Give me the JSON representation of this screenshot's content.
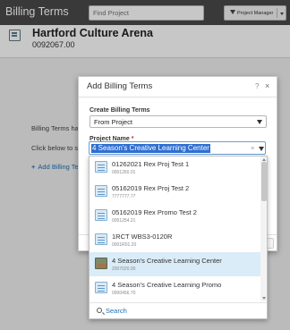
{
  "topbar": {
    "title": "Billing Terms",
    "search_placeholder": "Find Project",
    "filter_label": "Project Manager"
  },
  "record": {
    "title": "Hartford Culture Arena",
    "number": "0092067.00"
  },
  "page": {
    "note": "Billing Terms have not been set up for this record.",
    "click_below": "Click below to sta",
    "add_link": "Add Billing Te"
  },
  "modal": {
    "title": "Add Billing Terms",
    "help": "?",
    "close": "×",
    "create_label": "Create Billing Terms",
    "create_value": "From Project",
    "project_label": "Project Name",
    "required_mark": "*",
    "project_value": "4 Season's Creative Learning Center"
  },
  "dropdown": {
    "items": [
      {
        "name": "01262021 Rex Proj Test 1",
        "number": "0001260.01",
        "icon": "project-icon",
        "highlight": false
      },
      {
        "name": "05162019 Rex Proj Test 2",
        "number": "7777777.77",
        "icon": "project-icon",
        "highlight": false
      },
      {
        "name": "05162019 Rex Promo Test 2",
        "number": "0051254.21",
        "icon": "project-icon",
        "highlight": false
      },
      {
        "name": "1RCT WBS3-0120R",
        "number": "0001R01.20",
        "icon": "project-icon",
        "highlight": false
      },
      {
        "name": "4 Season's Creative Learning Center",
        "number": "2007020.00",
        "icon": "photo-thumbnail",
        "highlight": true
      },
      {
        "name": "4 Season's Creative Learning Promo",
        "number": "0000456.70",
        "icon": "project-icon",
        "highlight": false
      }
    ],
    "search_label": "Search"
  }
}
